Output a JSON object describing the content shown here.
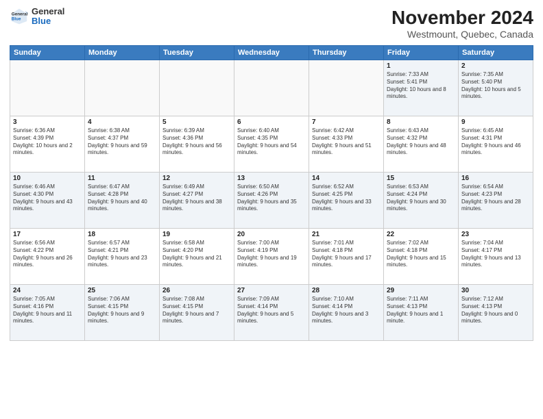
{
  "logo": {
    "line1": "General",
    "line2": "Blue"
  },
  "title": "November 2024",
  "location": "Westmount, Quebec, Canada",
  "weekdays": [
    "Sunday",
    "Monday",
    "Tuesday",
    "Wednesday",
    "Thursday",
    "Friday",
    "Saturday"
  ],
  "weeks": [
    [
      {
        "day": "",
        "info": ""
      },
      {
        "day": "",
        "info": ""
      },
      {
        "day": "",
        "info": ""
      },
      {
        "day": "",
        "info": ""
      },
      {
        "day": "",
        "info": ""
      },
      {
        "day": "1",
        "info": "Sunrise: 7:33 AM\nSunset: 5:41 PM\nDaylight: 10 hours and 8 minutes."
      },
      {
        "day": "2",
        "info": "Sunrise: 7:35 AM\nSunset: 5:40 PM\nDaylight: 10 hours and 5 minutes."
      }
    ],
    [
      {
        "day": "3",
        "info": "Sunrise: 6:36 AM\nSunset: 4:39 PM\nDaylight: 10 hours and 2 minutes."
      },
      {
        "day": "4",
        "info": "Sunrise: 6:38 AM\nSunset: 4:37 PM\nDaylight: 9 hours and 59 minutes."
      },
      {
        "day": "5",
        "info": "Sunrise: 6:39 AM\nSunset: 4:36 PM\nDaylight: 9 hours and 56 minutes."
      },
      {
        "day": "6",
        "info": "Sunrise: 6:40 AM\nSunset: 4:35 PM\nDaylight: 9 hours and 54 minutes."
      },
      {
        "day": "7",
        "info": "Sunrise: 6:42 AM\nSunset: 4:33 PM\nDaylight: 9 hours and 51 minutes."
      },
      {
        "day": "8",
        "info": "Sunrise: 6:43 AM\nSunset: 4:32 PM\nDaylight: 9 hours and 48 minutes."
      },
      {
        "day": "9",
        "info": "Sunrise: 6:45 AM\nSunset: 4:31 PM\nDaylight: 9 hours and 46 minutes."
      }
    ],
    [
      {
        "day": "10",
        "info": "Sunrise: 6:46 AM\nSunset: 4:30 PM\nDaylight: 9 hours and 43 minutes."
      },
      {
        "day": "11",
        "info": "Sunrise: 6:47 AM\nSunset: 4:28 PM\nDaylight: 9 hours and 40 minutes."
      },
      {
        "day": "12",
        "info": "Sunrise: 6:49 AM\nSunset: 4:27 PM\nDaylight: 9 hours and 38 minutes."
      },
      {
        "day": "13",
        "info": "Sunrise: 6:50 AM\nSunset: 4:26 PM\nDaylight: 9 hours and 35 minutes."
      },
      {
        "day": "14",
        "info": "Sunrise: 6:52 AM\nSunset: 4:25 PM\nDaylight: 9 hours and 33 minutes."
      },
      {
        "day": "15",
        "info": "Sunrise: 6:53 AM\nSunset: 4:24 PM\nDaylight: 9 hours and 30 minutes."
      },
      {
        "day": "16",
        "info": "Sunrise: 6:54 AM\nSunset: 4:23 PM\nDaylight: 9 hours and 28 minutes."
      }
    ],
    [
      {
        "day": "17",
        "info": "Sunrise: 6:56 AM\nSunset: 4:22 PM\nDaylight: 9 hours and 26 minutes."
      },
      {
        "day": "18",
        "info": "Sunrise: 6:57 AM\nSunset: 4:21 PM\nDaylight: 9 hours and 23 minutes."
      },
      {
        "day": "19",
        "info": "Sunrise: 6:58 AM\nSunset: 4:20 PM\nDaylight: 9 hours and 21 minutes."
      },
      {
        "day": "20",
        "info": "Sunrise: 7:00 AM\nSunset: 4:19 PM\nDaylight: 9 hours and 19 minutes."
      },
      {
        "day": "21",
        "info": "Sunrise: 7:01 AM\nSunset: 4:18 PM\nDaylight: 9 hours and 17 minutes."
      },
      {
        "day": "22",
        "info": "Sunrise: 7:02 AM\nSunset: 4:18 PM\nDaylight: 9 hours and 15 minutes."
      },
      {
        "day": "23",
        "info": "Sunrise: 7:04 AM\nSunset: 4:17 PM\nDaylight: 9 hours and 13 minutes."
      }
    ],
    [
      {
        "day": "24",
        "info": "Sunrise: 7:05 AM\nSunset: 4:16 PM\nDaylight: 9 hours and 11 minutes."
      },
      {
        "day": "25",
        "info": "Sunrise: 7:06 AM\nSunset: 4:15 PM\nDaylight: 9 hours and 9 minutes."
      },
      {
        "day": "26",
        "info": "Sunrise: 7:08 AM\nSunset: 4:15 PM\nDaylight: 9 hours and 7 minutes."
      },
      {
        "day": "27",
        "info": "Sunrise: 7:09 AM\nSunset: 4:14 PM\nDaylight: 9 hours and 5 minutes."
      },
      {
        "day": "28",
        "info": "Sunrise: 7:10 AM\nSunset: 4:14 PM\nDaylight: 9 hours and 3 minutes."
      },
      {
        "day": "29",
        "info": "Sunrise: 7:11 AM\nSunset: 4:13 PM\nDaylight: 9 hours and 1 minute."
      },
      {
        "day": "30",
        "info": "Sunrise: 7:12 AM\nSunset: 4:13 PM\nDaylight: 9 hours and 0 minutes."
      }
    ]
  ]
}
